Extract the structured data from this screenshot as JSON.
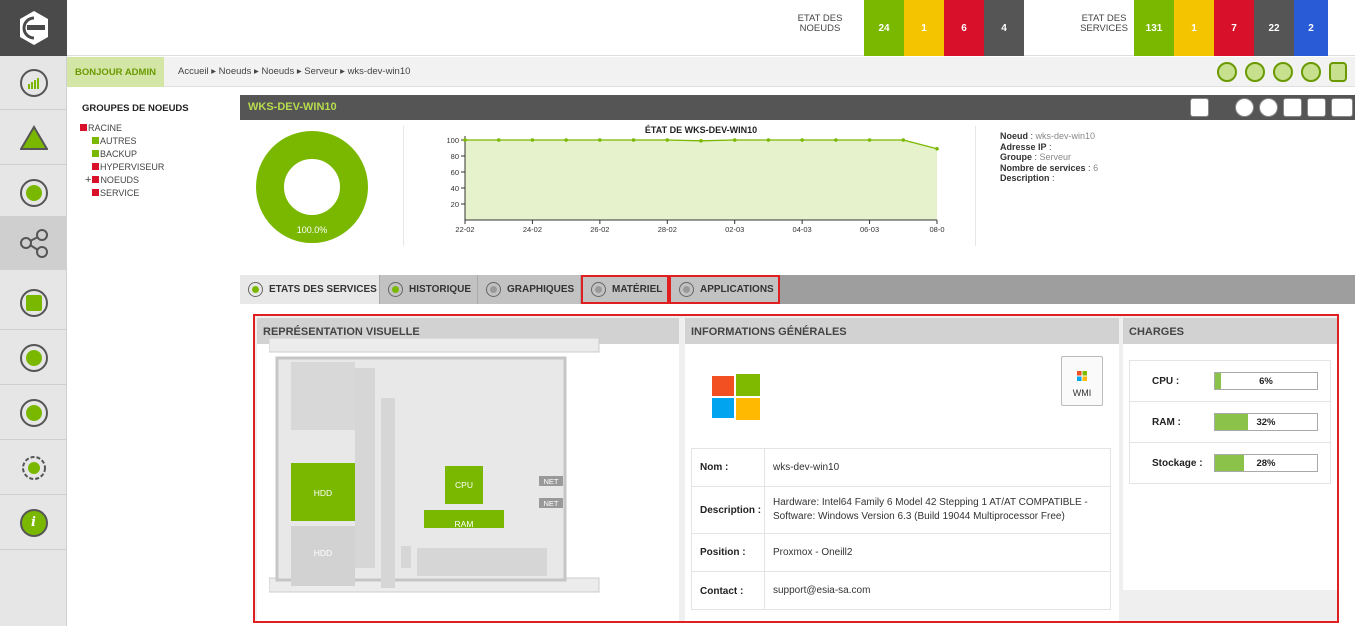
{
  "top_status": {
    "nodes_label_1": "ETAT DES",
    "nodes_label_2": "NOEUDS",
    "nodes_counts": [
      {
        "value": "24",
        "color": "#7ab800"
      },
      {
        "value": "1",
        "color": "#f5c400"
      },
      {
        "value": "6",
        "color": "#d8102a"
      },
      {
        "value": "4",
        "color": "#555555"
      }
    ],
    "services_label_1": "ETAT DES",
    "services_label_2": "SERVICES",
    "services_counts": [
      {
        "value": "131",
        "color": "#7ab800"
      },
      {
        "value": "1",
        "color": "#f5c400"
      },
      {
        "value": "7",
        "color": "#d8102a"
      },
      {
        "value": "22",
        "color": "#555555"
      },
      {
        "value": "2",
        "color": "#2a5bd7"
      }
    ]
  },
  "breadcrumb": {
    "greeting": "BONJOUR ADMIN",
    "path": "Accueil ▸ Noeuds ▸ Noeuds ▸ Serveur ▸ wks-dev-win10"
  },
  "groups": {
    "title": "GROUPES DE NOEUDS",
    "items": [
      {
        "label": "RACINE",
        "color": "#d8102a"
      },
      {
        "label": "AUTRES",
        "color": "#7ab800"
      },
      {
        "label": "BACKUP",
        "color": "#7ab800"
      },
      {
        "label": "HYPERVISEUR",
        "color": "#d8102a"
      },
      {
        "label": "NOEUDS",
        "color": "#d8102a",
        "expander": "+"
      },
      {
        "label": "SERVICE",
        "color": "#d8102a"
      }
    ]
  },
  "node": {
    "title": "WKS-DEV-WIN10",
    "donut_label": "100.0%",
    "chart_title": "ÉTAT DE WKS-DEV-WIN10",
    "details": {
      "noeud_label": "Noeud",
      "noeud_value": "wks-dev-win10",
      "ip_label": "Adresse IP",
      "ip_value": "",
      "groupe_label": "Groupe",
      "groupe_value": "Serveur",
      "nbservices_label": "Nombre de services",
      "nbservices_value": "6",
      "description_label": "Description",
      "description_value": ""
    }
  },
  "chart_data": {
    "type": "area",
    "title": "ÉTAT DE WKS-DEV-WIN10",
    "x": [
      "22-02",
      "23-02",
      "24-02",
      "25-02",
      "26-02",
      "27-02",
      "28-02",
      "01-03",
      "02-03",
      "03-03",
      "04-03",
      "05-03",
      "06-03",
      "07-03",
      "08-03"
    ],
    "x_tick_labels": [
      "22-02",
      "24-02",
      "26-02",
      "28-02",
      "02-03",
      "04-03",
      "06-03",
      "08-0"
    ],
    "y_ticks": [
      "100",
      "80",
      "60",
      "40",
      "20"
    ],
    "values": [
      100,
      100,
      100,
      100,
      100,
      100,
      100,
      99,
      100,
      100,
      100,
      100,
      100,
      100,
      89
    ],
    "ylim": [
      0,
      100
    ],
    "colors": {
      "line": "#7ab800",
      "fill": "#e6f2cc"
    }
  },
  "donut": {
    "percent": 100,
    "color": "#7ab800"
  },
  "tabs": [
    {
      "label": "ETATS DES SERVICES"
    },
    {
      "label": "HISTORIQUE"
    },
    {
      "label": "GRAPHIQUES"
    },
    {
      "label": "MATÉRIEL"
    },
    {
      "label": "APPLICATIONS"
    }
  ],
  "sections": {
    "visual": "REPRÉSENTATION VISUELLE",
    "info": "INFORMATIONS GÉNÉRALES",
    "charges": "CHARGES"
  },
  "hardware_labels": {
    "hdd1": "HDD",
    "hdd2": "HDD",
    "cpu": "CPU",
    "ram": "RAM",
    "net1": "NET",
    "net2": "NET"
  },
  "wmi_label": "WMI",
  "info": {
    "nom_label": "Nom :",
    "nom": "wks-dev-win10",
    "description_label": "Description :",
    "description": "Hardware: Intel64 Family 6 Model 42 Stepping 1 AT/AT COMPATIBLE - Software: Windows Version 6.3 (Build 19044 Multiprocessor Free)",
    "position_label": "Position :",
    "position": "Proxmox - Oneill2",
    "contact_label": "Contact :",
    "contact": "support@esia-sa.com"
  },
  "charges": [
    {
      "label": "CPU :",
      "value": "6%",
      "fraction": 0.06
    },
    {
      "label": "RAM :",
      "value": "32%",
      "fraction": 0.32
    },
    {
      "label": "Stockage :",
      "value": "28%",
      "fraction": 0.28
    }
  ]
}
